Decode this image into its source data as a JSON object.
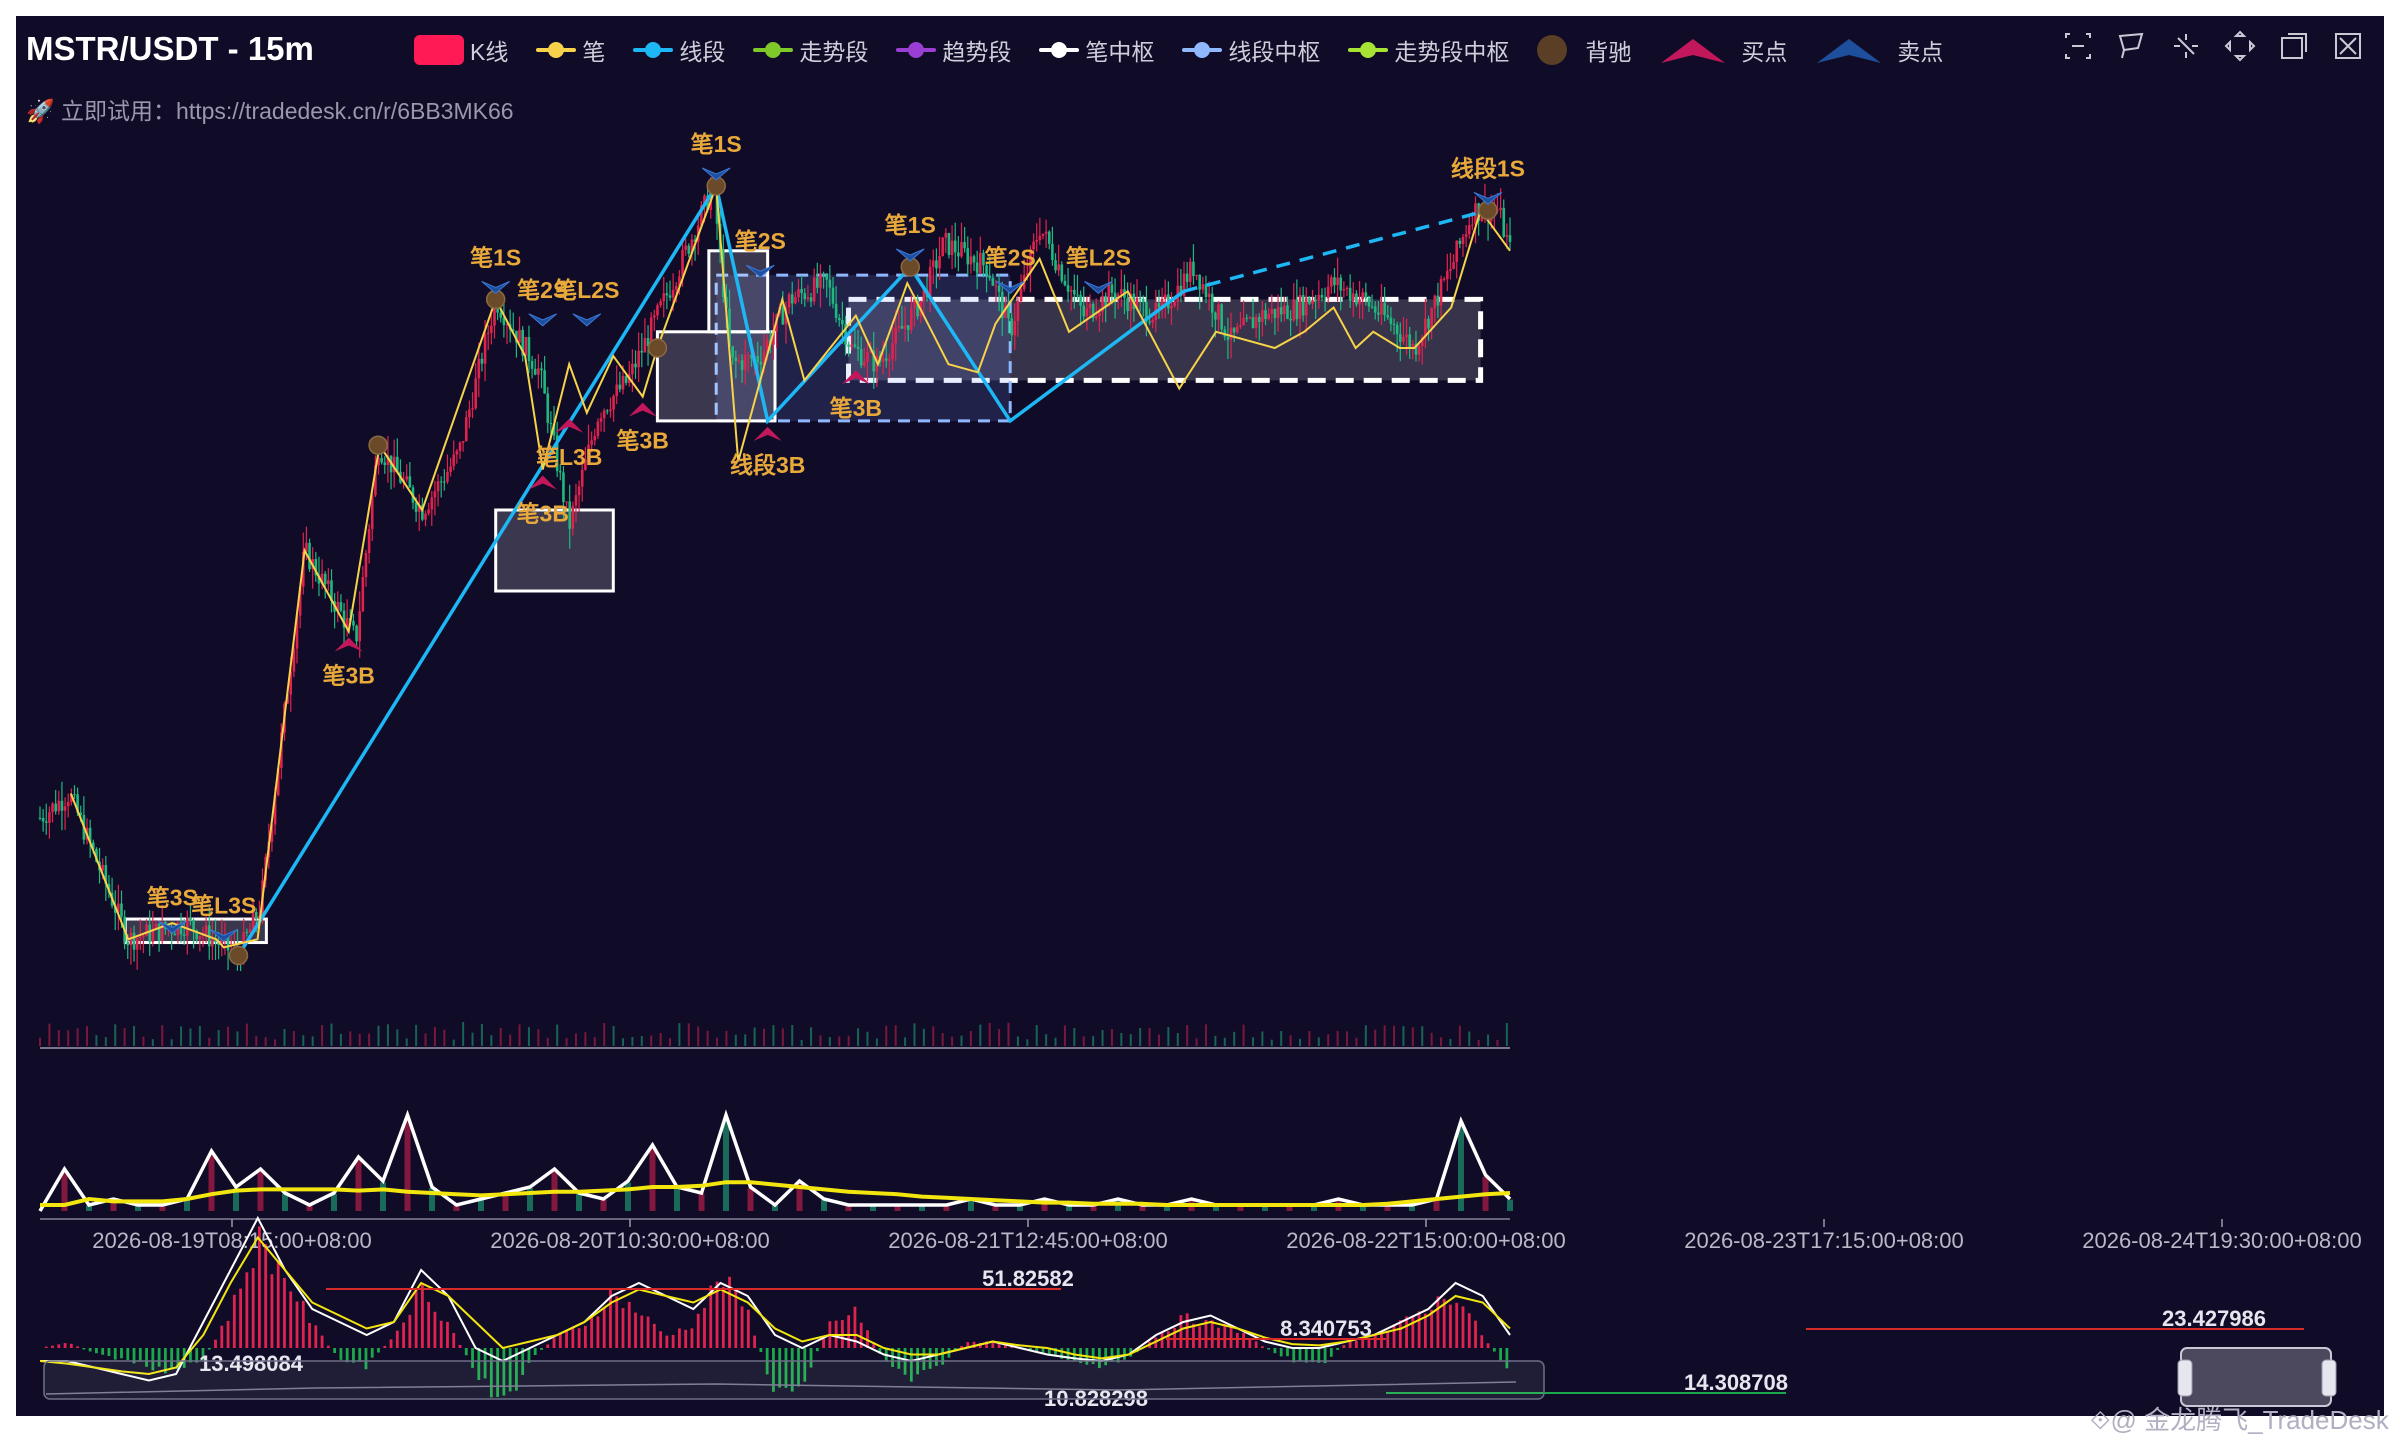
{
  "header": {
    "title": "MSTR/USDT - 15m",
    "promo": "🚀 立即试用：https://tradedesk.cn/r/6BB3MK66"
  },
  "legend": [
    {
      "label": "K线",
      "color": "#ff1a55",
      "kind": "rect"
    },
    {
      "label": "笔",
      "color": "#f6d34a",
      "kind": "line"
    },
    {
      "label": "线段",
      "color": "#1db7f5",
      "kind": "line"
    },
    {
      "label": "走势段",
      "color": "#7ec82a",
      "kind": "line"
    },
    {
      "label": "趋势段",
      "color": "#9b3fd4",
      "kind": "line"
    },
    {
      "label": "笔中枢",
      "color": "#ffffff",
      "kind": "line"
    },
    {
      "label": "线段中枢",
      "color": "#8fb8ff",
      "kind": "line"
    },
    {
      "label": "走势段中枢",
      "color": "#a6e334",
      "kind": "line"
    },
    {
      "label": "背驰",
      "color": "#5a3e25",
      "kind": "dot"
    },
    {
      "label": "买点",
      "color": "#c2185b",
      "kind": "tri"
    },
    {
      "label": "卖点",
      "color": "#1d4f9c",
      "kind": "tri"
    }
  ],
  "toolbar": [
    {
      "name": "zoom-select-icon"
    },
    {
      "name": "lasso-select-icon"
    },
    {
      "name": "zoom-icon"
    },
    {
      "name": "expand-icon"
    },
    {
      "name": "restore-icon"
    },
    {
      "name": "clear-icon"
    }
  ],
  "watermark": "⟐@ 金龙腾飞_TradeDesk",
  "colors": {
    "bg": "#100c28",
    "up": "#e0234e",
    "down": "#1fb980",
    "bi": "#f6d34a",
    "xd": "#1db7f5",
    "annot": "#e8a93a",
    "buy": "#c2185b",
    "sell": "#1d4f9c",
    "divergence": "#6b4a2a",
    "vol_line_white": "#ffffff",
    "vol_line_yellow": "#f2e60e",
    "macd_pos": "#e0234e",
    "macd_neg": "#1aa84a"
  },
  "chart_data": [
    {
      "type": "line",
      "subtype": "candlestick-chan",
      "x_ticks": [
        "2026-08-19T08:15:00+08:00",
        "2026-08-20T10:30:00+08:00",
        "2026-08-21T12:45:00+08:00",
        "2026-08-22T15:00:00+08:00",
        "2026-08-23T17:15:00+08:00",
        "2026-08-24T19:30:00+08:00"
      ],
      "price_ylim": [
        0.0,
        1.0
      ],
      "price_path": [
        [
          0.0,
          0.22
        ],
        [
          0.02,
          0.25
        ],
        [
          0.06,
          0.07
        ],
        [
          0.1,
          0.09
        ],
        [
          0.135,
          0.05
        ],
        [
          0.15,
          0.11
        ],
        [
          0.18,
          0.55
        ],
        [
          0.215,
          0.44
        ],
        [
          0.23,
          0.68
        ],
        [
          0.26,
          0.6
        ],
        [
          0.285,
          0.67
        ],
        [
          0.31,
          0.86
        ],
        [
          0.34,
          0.77
        ],
        [
          0.36,
          0.58
        ],
        [
          0.38,
          0.72
        ],
        [
          0.4,
          0.76
        ],
        [
          0.435,
          0.9
        ],
        [
          0.458,
          1.0
        ],
        [
          0.47,
          0.78
        ],
        [
          0.49,
          0.79
        ],
        [
          0.51,
          0.86
        ],
        [
          0.535,
          0.88
        ],
        [
          0.552,
          0.8
        ],
        [
          0.57,
          0.78
        ],
        [
          0.6,
          0.86
        ],
        [
          0.615,
          0.93
        ],
        [
          0.645,
          0.9
        ],
        [
          0.66,
          0.82
        ],
        [
          0.68,
          0.95
        ],
        [
          0.71,
          0.84
        ],
        [
          0.73,
          0.87
        ],
        [
          0.76,
          0.84
        ],
        [
          0.785,
          0.9
        ],
        [
          0.81,
          0.81
        ],
        [
          0.83,
          0.84
        ],
        [
          0.855,
          0.85
        ],
        [
          0.88,
          0.88
        ],
        [
          0.9,
          0.86
        ],
        [
          0.92,
          0.83
        ],
        [
          0.935,
          0.8
        ],
        [
          0.96,
          0.9
        ],
        [
          0.975,
          0.97
        ],
        [
          0.992,
          0.97
        ],
        [
          1.0,
          0.92
        ]
      ],
      "bi": [
        [
          0.021,
          0.25
        ],
        [
          0.06,
          0.07
        ],
        [
          0.09,
          0.09
        ],
        [
          0.12,
          0.07
        ],
        [
          0.125,
          0.06
        ],
        [
          0.148,
          0.07
        ],
        [
          0.18,
          0.55
        ],
        [
          0.21,
          0.45
        ],
        [
          0.231,
          0.68
        ],
        [
          0.26,
          0.6
        ],
        [
          0.31,
          0.86
        ],
        [
          0.33,
          0.79
        ],
        [
          0.342,
          0.65
        ],
        [
          0.36,
          0.78
        ],
        [
          0.372,
          0.72
        ],
        [
          0.39,
          0.79
        ],
        [
          0.41,
          0.74
        ],
        [
          0.42,
          0.8
        ],
        [
          0.46,
          1.0
        ],
        [
          0.475,
          0.66
        ],
        [
          0.505,
          0.86
        ],
        [
          0.52,
          0.76
        ],
        [
          0.555,
          0.84
        ],
        [
          0.57,
          0.78
        ],
        [
          0.59,
          0.88
        ],
        [
          0.618,
          0.78
        ],
        [
          0.638,
          0.77
        ],
        [
          0.65,
          0.83
        ],
        [
          0.68,
          0.91
        ],
        [
          0.7,
          0.82
        ],
        [
          0.74,
          0.87
        ],
        [
          0.775,
          0.75
        ],
        [
          0.8,
          0.82
        ],
        [
          0.84,
          0.8
        ],
        [
          0.86,
          0.82
        ],
        [
          0.88,
          0.85
        ],
        [
          0.895,
          0.8
        ],
        [
          0.907,
          0.82
        ],
        [
          0.925,
          0.8
        ],
        [
          0.935,
          0.8
        ],
        [
          0.96,
          0.85
        ],
        [
          0.98,
          0.97
        ],
        [
          1.0,
          0.92
        ]
      ],
      "xd": [
        [
          0.135,
          0.05
        ],
        [
          0.46,
          1.0
        ],
        [
          0.495,
          0.71
        ],
        [
          0.592,
          0.9
        ],
        [
          0.66,
          0.71
        ],
        [
          0.778,
          0.87
        ],
        [
          0.985,
          0.97
        ]
      ],
      "bi_centers": [
        [
          0.058,
          0.066,
          0.154,
          0.095
        ],
        [
          0.195,
          0.52,
          0.265,
          0.52
        ],
        [
          0.31,
          0.5,
          0.39,
          0.6
        ],
        [
          0.42,
          0.71,
          0.5,
          0.82
        ],
        [
          0.455,
          0.82,
          0.495,
          0.92
        ]
      ],
      "xd_centers": [
        [
          0.46,
          0.71,
          0.66,
          0.89
        ]
      ],
      "trend_centers": [
        [
          0.55,
          0.76,
          0.98,
          0.86
        ]
      ],
      "signals": [
        {
          "label": "笔3S",
          "kind": "sell",
          "at": [
            0.09,
            0.07
          ]
        },
        {
          "label": "笔L3S",
          "kind": "sell",
          "at": [
            0.125,
            0.06
          ]
        },
        {
          "label": "笔3B",
          "kind": "buy",
          "at": [
            0.21,
            0.45
          ]
        },
        {
          "label": "笔1S",
          "kind": "sell",
          "at": [
            0.31,
            0.86
          ]
        },
        {
          "label": "笔2S",
          "kind": "sell",
          "at": [
            0.342,
            0.82
          ]
        },
        {
          "label": "笔L2S",
          "kind": "sell",
          "at": [
            0.372,
            0.82
          ]
        },
        {
          "label": "笔3B",
          "kind": "buy",
          "at": [
            0.342,
            0.65
          ]
        },
        {
          "label": "笔L3B",
          "kind": "buy",
          "at": [
            0.36,
            0.72
          ]
        },
        {
          "label": "笔3B",
          "kind": "buy",
          "at": [
            0.41,
            0.74
          ]
        },
        {
          "label": "笔1S",
          "kind": "sell",
          "at": [
            0.46,
            1.0
          ]
        },
        {
          "label": "笔2S",
          "kind": "sell",
          "at": [
            0.49,
            0.88
          ]
        },
        {
          "label": "线段3B",
          "kind": "buy",
          "at": [
            0.495,
            0.71
          ]
        },
        {
          "label": "笔3B",
          "kind": "buy",
          "at": [
            0.555,
            0.78
          ]
        },
        {
          "label": "笔1S",
          "kind": "sell",
          "at": [
            0.592,
            0.9
          ]
        },
        {
          "label": "笔2S",
          "kind": "sell",
          "at": [
            0.66,
            0.86
          ]
        },
        {
          "label": "笔L2S",
          "kind": "sell",
          "at": [
            0.72,
            0.86
          ]
        },
        {
          "label": "线段1S",
          "kind": "sell",
          "at": [
            0.985,
            0.97
          ]
        }
      ],
      "divergence": [
        [
          0.135,
          0.05
        ],
        [
          0.23,
          0.68
        ],
        [
          0.31,
          0.86
        ],
        [
          0.42,
          0.8
        ],
        [
          0.46,
          1.0
        ],
        [
          0.592,
          0.9
        ],
        [
          0.985,
          0.97
        ]
      ]
    },
    {
      "type": "area",
      "title": "",
      "series": [
        {
          "name": "",
          "values": [
            0.0,
            0.35,
            0.05,
            0.1,
            0.05,
            0.05,
            0.1,
            0.5,
            0.2,
            0.35,
            0.15,
            0.05,
            0.15,
            0.45,
            0.25,
            0.8,
            0.2,
            0.05,
            0.1,
            0.15,
            0.2,
            0.35,
            0.15,
            0.1,
            0.25,
            0.55,
            0.2,
            0.15,
            0.8,
            0.2,
            0.05,
            0.25,
            0.1,
            0.05,
            0.05,
            0.05,
            0.05,
            0.05,
            0.1,
            0.05,
            0.05,
            0.1,
            0.05,
            0.05,
            0.1,
            0.05,
            0.05,
            0.1,
            0.05,
            0.05,
            0.05,
            0.05,
            0.05,
            0.1,
            0.05,
            0.05,
            0.05,
            0.1,
            0.75,
            0.3,
            0.1
          ]
        },
        {
          "name": "",
          "values": [
            0.05,
            0.05,
            0.1,
            0.08,
            0.08,
            0.08,
            0.1,
            0.14,
            0.17,
            0.18,
            0.18,
            0.18,
            0.18,
            0.17,
            0.18,
            0.16,
            0.15,
            0.14,
            0.13,
            0.14,
            0.15,
            0.16,
            0.16,
            0.17,
            0.18,
            0.2,
            0.2,
            0.21,
            0.24,
            0.24,
            0.22,
            0.2,
            0.18,
            0.16,
            0.15,
            0.14,
            0.12,
            0.11,
            0.1,
            0.09,
            0.08,
            0.07,
            0.07,
            0.06,
            0.06,
            0.06,
            0.05,
            0.05,
            0.05,
            0.05,
            0.05,
            0.05,
            0.05,
            0.05,
            0.05,
            0.06,
            0.08,
            0.1,
            0.12,
            0.14,
            0.15
          ]
        }
      ]
    },
    {
      "type": "bar",
      "title": "",
      "annotations": [
        "51.82582",
        "8.340753",
        "23.427986",
        "13.498084",
        "10.828298",
        "14.308708"
      ],
      "series": [
        {
          "name": "",
          "values": [
            0.0,
            0.05,
            -0.05,
            -0.1,
            -0.15,
            -0.2,
            -0.1,
            0.3,
            0.9,
            0.6,
            0.2,
            -0.1,
            -0.15,
            0.1,
            0.5,
            0.2,
            -0.2,
            -0.5,
            -0.1,
            0.1,
            0.2,
            0.45,
            0.3,
            0.1,
            0.2,
            0.6,
            0.3,
            -0.4,
            -0.3,
            0.2,
            0.3,
            -0.1,
            -0.25,
            -0.15,
            0.05,
            0.05,
            0.0,
            -0.05,
            -0.1,
            -0.15,
            -0.1,
            0.1,
            0.25,
            0.2,
            0.15,
            0.0,
            -0.1,
            -0.15,
            0.05,
            0.1,
            0.2,
            0.35,
            0.45,
            0.1,
            -0.2
          ]
        },
        {
          "name": "",
          "values": [
            -0.1,
            -0.1,
            -0.15,
            -0.2,
            -0.25,
            -0.2,
            0.2,
            0.6,
            1.0,
            0.6,
            0.3,
            0.2,
            0.1,
            0.2,
            0.6,
            0.4,
            0.0,
            -0.1,
            0.0,
            0.1,
            0.2,
            0.4,
            0.5,
            0.4,
            0.3,
            0.5,
            0.4,
            0.1,
            0.0,
            0.1,
            0.05,
            -0.05,
            -0.1,
            -0.05,
            0.0,
            0.05,
            0.0,
            -0.05,
            -0.08,
            -0.1,
            -0.05,
            0.1,
            0.2,
            0.25,
            0.15,
            0.05,
            0.0,
            0.0,
            0.05,
            0.1,
            0.2,
            0.3,
            0.5,
            0.4,
            0.1
          ]
        },
        {
          "name": "",
          "values": [
            -0.1,
            -0.12,
            -0.15,
            -0.18,
            -0.2,
            -0.15,
            0.1,
            0.5,
            0.85,
            0.6,
            0.35,
            0.25,
            0.15,
            0.2,
            0.5,
            0.4,
            0.2,
            0.0,
            0.05,
            0.1,
            0.2,
            0.35,
            0.45,
            0.4,
            0.35,
            0.45,
            0.35,
            0.15,
            0.05,
            0.1,
            0.1,
            0.0,
            -0.05,
            -0.05,
            0.0,
            0.05,
            0.02,
            0.0,
            -0.05,
            -0.08,
            -0.05,
            0.05,
            0.15,
            0.2,
            0.15,
            0.08,
            0.03,
            0.02,
            0.05,
            0.1,
            0.15,
            0.25,
            0.4,
            0.35,
            0.15
          ]
        }
      ]
    }
  ]
}
